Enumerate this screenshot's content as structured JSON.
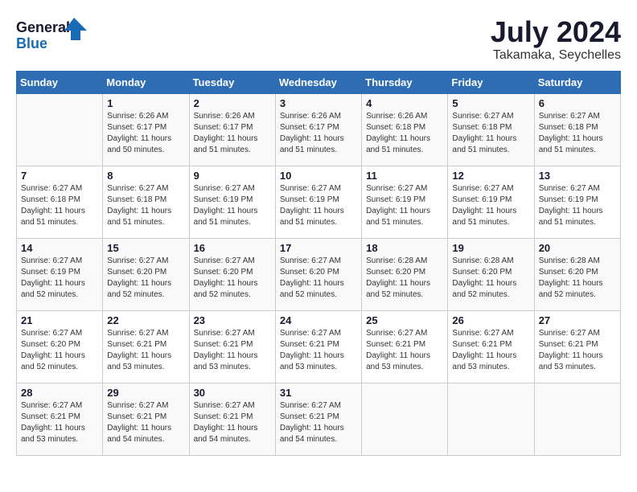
{
  "logo": {
    "line1": "General",
    "line2": "Blue"
  },
  "title": "July 2024",
  "subtitle": "Takamaka, Seychelles",
  "days_of_week": [
    "Sunday",
    "Monday",
    "Tuesday",
    "Wednesday",
    "Thursday",
    "Friday",
    "Saturday"
  ],
  "weeks": [
    [
      {
        "day": "",
        "info": ""
      },
      {
        "day": "1",
        "info": "Sunrise: 6:26 AM\nSunset: 6:17 PM\nDaylight: 11 hours\nand 50 minutes."
      },
      {
        "day": "2",
        "info": "Sunrise: 6:26 AM\nSunset: 6:17 PM\nDaylight: 11 hours\nand 51 minutes."
      },
      {
        "day": "3",
        "info": "Sunrise: 6:26 AM\nSunset: 6:17 PM\nDaylight: 11 hours\nand 51 minutes."
      },
      {
        "day": "4",
        "info": "Sunrise: 6:26 AM\nSunset: 6:18 PM\nDaylight: 11 hours\nand 51 minutes."
      },
      {
        "day": "5",
        "info": "Sunrise: 6:27 AM\nSunset: 6:18 PM\nDaylight: 11 hours\nand 51 minutes."
      },
      {
        "day": "6",
        "info": "Sunrise: 6:27 AM\nSunset: 6:18 PM\nDaylight: 11 hours\nand 51 minutes."
      }
    ],
    [
      {
        "day": "7",
        "info": "Sunrise: 6:27 AM\nSunset: 6:18 PM\nDaylight: 11 hours\nand 51 minutes."
      },
      {
        "day": "8",
        "info": "Sunrise: 6:27 AM\nSunset: 6:18 PM\nDaylight: 11 hours\nand 51 minutes."
      },
      {
        "day": "9",
        "info": "Sunrise: 6:27 AM\nSunset: 6:19 PM\nDaylight: 11 hours\nand 51 minutes."
      },
      {
        "day": "10",
        "info": "Sunrise: 6:27 AM\nSunset: 6:19 PM\nDaylight: 11 hours\nand 51 minutes."
      },
      {
        "day": "11",
        "info": "Sunrise: 6:27 AM\nSunset: 6:19 PM\nDaylight: 11 hours\nand 51 minutes."
      },
      {
        "day": "12",
        "info": "Sunrise: 6:27 AM\nSunset: 6:19 PM\nDaylight: 11 hours\nand 51 minutes."
      },
      {
        "day": "13",
        "info": "Sunrise: 6:27 AM\nSunset: 6:19 PM\nDaylight: 11 hours\nand 51 minutes."
      }
    ],
    [
      {
        "day": "14",
        "info": "Sunrise: 6:27 AM\nSunset: 6:19 PM\nDaylight: 11 hours\nand 52 minutes."
      },
      {
        "day": "15",
        "info": "Sunrise: 6:27 AM\nSunset: 6:20 PM\nDaylight: 11 hours\nand 52 minutes."
      },
      {
        "day": "16",
        "info": "Sunrise: 6:27 AM\nSunset: 6:20 PM\nDaylight: 11 hours\nand 52 minutes."
      },
      {
        "day": "17",
        "info": "Sunrise: 6:27 AM\nSunset: 6:20 PM\nDaylight: 11 hours\nand 52 minutes."
      },
      {
        "day": "18",
        "info": "Sunrise: 6:28 AM\nSunset: 6:20 PM\nDaylight: 11 hours\nand 52 minutes."
      },
      {
        "day": "19",
        "info": "Sunrise: 6:28 AM\nSunset: 6:20 PM\nDaylight: 11 hours\nand 52 minutes."
      },
      {
        "day": "20",
        "info": "Sunrise: 6:28 AM\nSunset: 6:20 PM\nDaylight: 11 hours\nand 52 minutes."
      }
    ],
    [
      {
        "day": "21",
        "info": "Sunrise: 6:27 AM\nSunset: 6:20 PM\nDaylight: 11 hours\nand 52 minutes."
      },
      {
        "day": "22",
        "info": "Sunrise: 6:27 AM\nSunset: 6:21 PM\nDaylight: 11 hours\nand 53 minutes."
      },
      {
        "day": "23",
        "info": "Sunrise: 6:27 AM\nSunset: 6:21 PM\nDaylight: 11 hours\nand 53 minutes."
      },
      {
        "day": "24",
        "info": "Sunrise: 6:27 AM\nSunset: 6:21 PM\nDaylight: 11 hours\nand 53 minutes."
      },
      {
        "day": "25",
        "info": "Sunrise: 6:27 AM\nSunset: 6:21 PM\nDaylight: 11 hours\nand 53 minutes."
      },
      {
        "day": "26",
        "info": "Sunrise: 6:27 AM\nSunset: 6:21 PM\nDaylight: 11 hours\nand 53 minutes."
      },
      {
        "day": "27",
        "info": "Sunrise: 6:27 AM\nSunset: 6:21 PM\nDaylight: 11 hours\nand 53 minutes."
      }
    ],
    [
      {
        "day": "28",
        "info": "Sunrise: 6:27 AM\nSunset: 6:21 PM\nDaylight: 11 hours\nand 53 minutes."
      },
      {
        "day": "29",
        "info": "Sunrise: 6:27 AM\nSunset: 6:21 PM\nDaylight: 11 hours\nand 54 minutes."
      },
      {
        "day": "30",
        "info": "Sunrise: 6:27 AM\nSunset: 6:21 PM\nDaylight: 11 hours\nand 54 minutes."
      },
      {
        "day": "31",
        "info": "Sunrise: 6:27 AM\nSunset: 6:21 PM\nDaylight: 11 hours\nand 54 minutes."
      },
      {
        "day": "",
        "info": ""
      },
      {
        "day": "",
        "info": ""
      },
      {
        "day": "",
        "info": ""
      }
    ]
  ]
}
